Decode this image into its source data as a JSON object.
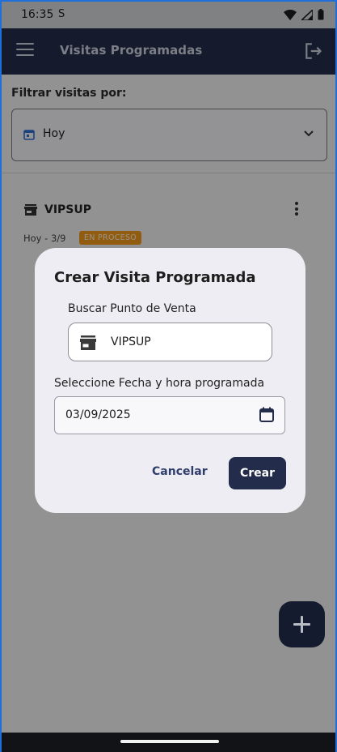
{
  "status_bar": {
    "time": "16:35",
    "sim_indicator": "S",
    "icons": [
      "wifi-icon",
      "signal-icon",
      "battery-icon"
    ]
  },
  "app_bar": {
    "title": "Visitas Programadas",
    "menu_icon": "menu-icon",
    "logout_icon": "logout-icon"
  },
  "filter": {
    "label": "Filtrar visitas por:",
    "selected": "Hoy",
    "icon": "calendar-icon"
  },
  "visits": [
    {
      "name": "VIPSUP",
      "date": "Hoy - 3/9",
      "status": "EN PROCESO",
      "status_color": "#f29a19"
    }
  ],
  "dialog": {
    "title": "Crear Visita Programada",
    "point_of_sale_label": "Buscar Punto de Venta",
    "point_of_sale_value": "VIPSUP",
    "datetime_label": "Seleccione Fecha y hora programada",
    "date_value": "03/09/2025",
    "cancel_label": "Cancelar",
    "create_label": "Crear"
  },
  "colors": {
    "primary": "#232d4b",
    "badge": "#f29a19",
    "dialog_bg": "#eeedf3"
  }
}
